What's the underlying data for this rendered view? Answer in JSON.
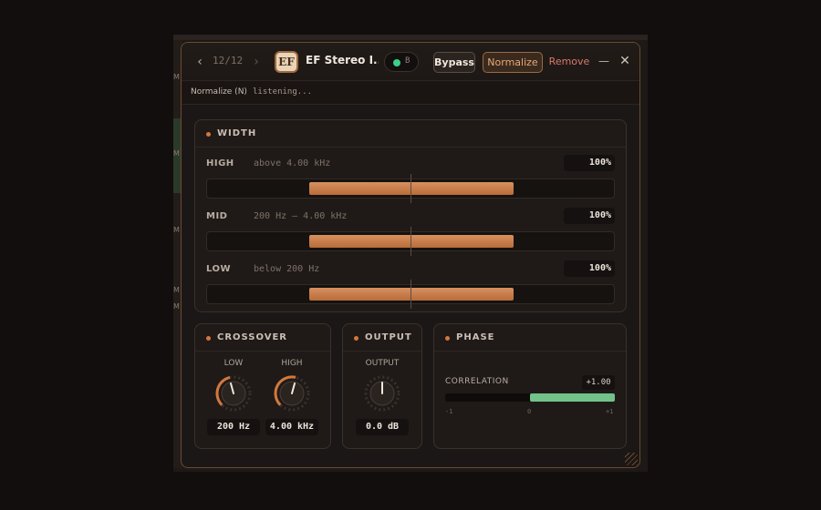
{
  "host": {
    "side_labels": [
      "M",
      "M",
      "M",
      "M",
      "M"
    ]
  },
  "titlebar": {
    "nav_prev_icon": "chevron-left-icon",
    "counter": "12/12",
    "nav_next_icon": "chevron-right-icon",
    "logo_text": "EF",
    "plugin_name": "EF Stereo I...",
    "preset_label": "B",
    "bypass_label": "Bypass",
    "normalize_label": "Normalize",
    "remove_label": "Remove",
    "minimize_glyph": "—",
    "close_glyph": "✕"
  },
  "status": {
    "key": "Normalize (N)",
    "value": "listening..."
  },
  "width": {
    "title": "WIDTH",
    "bands": [
      {
        "name": "HIGH",
        "range": "above 4.00 kHz",
        "value": "100%",
        "width_pct": 100
      },
      {
        "name": "MID",
        "range": "200 Hz – 4.00 kHz",
        "value": "100%",
        "width_pct": 100
      },
      {
        "name": "LOW",
        "range": "below 200 Hz",
        "value": "100%",
        "width_pct": 100
      }
    ]
  },
  "crossover": {
    "title": "CROSSOVER",
    "low": {
      "label": "LOW",
      "value": "200 Hz"
    },
    "high": {
      "label": "HIGH",
      "value": "4.00 kHz"
    }
  },
  "output": {
    "title": "OUTPUT",
    "knob_label": "OUTPUT",
    "value": "0.0 dB"
  },
  "phase": {
    "title": "PHASE",
    "correlation_label": "CORRELATION",
    "correlation_value": "+1.00",
    "correlation": 1.0,
    "ticks": [
      "-1",
      "0",
      "+1"
    ]
  },
  "colors": {
    "accent": "#d2783c",
    "fill": "#c47a45",
    "correlation": "#72c28a",
    "remove": "#d8786a"
  }
}
